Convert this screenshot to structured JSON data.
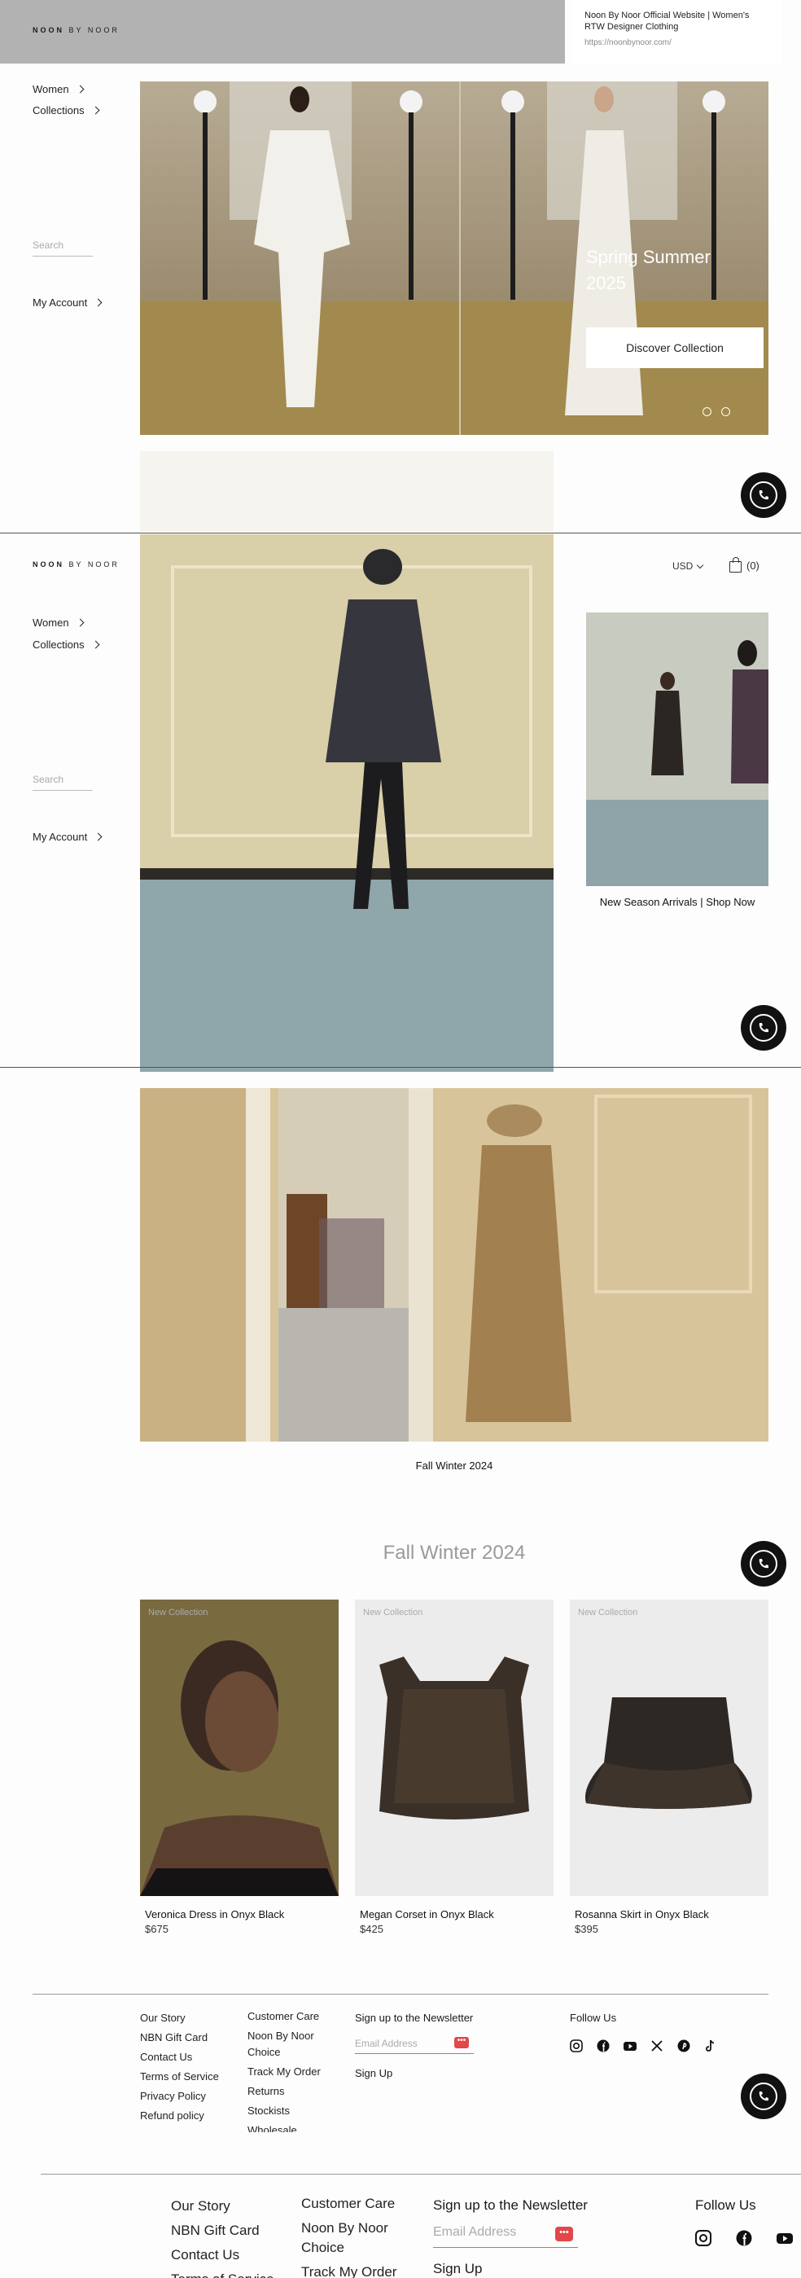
{
  "tooltip": {
    "title": "Noon By Noor Official Website | Women's RTW Designer Clothing",
    "url": "https://noonbynoor.com/"
  },
  "header": {
    "logo_main": "NOON",
    "logo_rest": "BY NOOR",
    "currency": "USD",
    "cart_count": "(0)"
  },
  "sidebar": {
    "items": [
      {
        "label": "Women"
      },
      {
        "label": "Collections"
      }
    ],
    "search_placeholder": "Search",
    "account_label": "My Account"
  },
  "hero": {
    "title_line1": "Spring Summer",
    "title_line2": "2025",
    "cta": "Discover Collection"
  },
  "feature2": {
    "caption": "New Season Arrivals | Shop Now"
  },
  "feature3": {
    "caption": "Fall Winter 2024"
  },
  "collection": {
    "title": "Fall Winter 2024",
    "products": [
      {
        "badge": "New Collection",
        "name": "Veronica Dress in Onyx Black",
        "price": "$675"
      },
      {
        "badge": "New Collection",
        "name": "Megan Corset in Onyx Black",
        "price": "$425"
      },
      {
        "badge": "New Collection",
        "name": "Rosanna Skirt in Onyx Black",
        "price": "$395"
      }
    ]
  },
  "footer": {
    "col1": [
      "Our Story",
      "NBN Gift Card",
      "Contact Us",
      "Terms of Service",
      "Privacy Policy",
      "Refund policy"
    ],
    "col2": [
      "Customer Care",
      "Noon By Noor Choice",
      "Track My Order",
      "Returns",
      "Stockists",
      "Wholesale"
    ],
    "newsletter_title": "Sign up to the Newsletter",
    "email_placeholder": "Email Address",
    "signup": "Sign Up",
    "follow": "Follow Us",
    "social_icons": [
      "instagram-icon",
      "facebook-icon",
      "youtube-icon",
      "x-icon",
      "pinterest-icon",
      "tiktok-icon"
    ]
  },
  "footer_large": {
    "col1": [
      "Our Story",
      "NBN Gift Card",
      "Contact Us",
      "Terms of Service"
    ],
    "col2_line1": "Customer Care",
    "col2_line2": "Noon By Noor",
    "col2_line3": "Choice",
    "col2_line4": "Track My Order",
    "newsletter_title": "Sign up to the Newsletter",
    "email_placeholder": "Email Address",
    "signup": "Sign Up",
    "follow": "Follow Us"
  },
  "colors": {
    "accent_red": "#e0484b",
    "dark": "#111111"
  }
}
